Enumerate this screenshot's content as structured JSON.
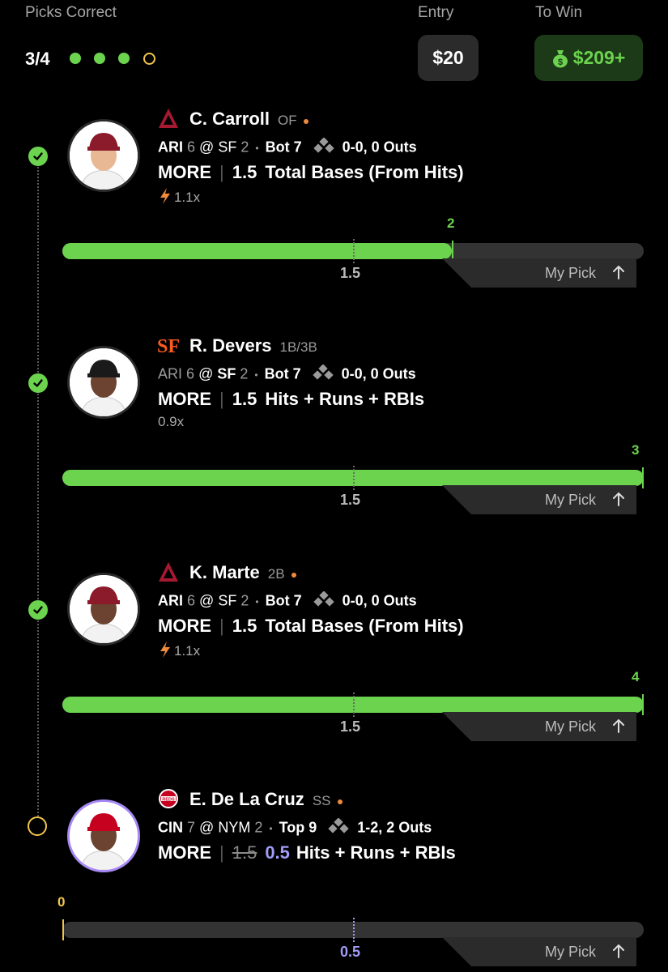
{
  "header": {
    "picks_label": "Picks Correct",
    "picks_count": "3/4",
    "progress": [
      true,
      true,
      true,
      false
    ],
    "entry_label": "Entry",
    "entry_value": "$20",
    "win_label": "To Win",
    "win_value": "$209+"
  },
  "picks": [
    {
      "player": "C. Carroll",
      "position": "OF",
      "live_dot": true,
      "team_logo": "diamondbacks-logo",
      "away": "ARI",
      "away_score": "6",
      "at": "@",
      "home": "SF",
      "home_score": "2",
      "inning": "Bot 7",
      "count": "0-0, 0 Outs",
      "direction": "MORE",
      "line": "1.5",
      "stat": "Total Bases (From Hits)",
      "multiplier": "1.1x",
      "boost_icon": true,
      "current": "2",
      "line_label": "1.5",
      "status": "correct",
      "progress_fraction": 0.67,
      "line_fraction": 0.5,
      "my_pick_label": "My Pick"
    },
    {
      "player": "R. Devers",
      "position": "1B/3B",
      "live_dot": false,
      "team_logo": "giants-logo",
      "away": "ARI",
      "away_score": "6",
      "at": "@",
      "home": "SF",
      "home_score": "2",
      "inning": "Bot 7",
      "count": "0-0, 0 Outs",
      "direction": "MORE",
      "line": "1.5",
      "stat": "Hits + Runs + RBIs",
      "multiplier": "0.9x",
      "boost_icon": false,
      "current": "3",
      "line_label": "1.5",
      "status": "correct",
      "progress_fraction": 1.0,
      "line_fraction": 0.5,
      "my_pick_label": "My Pick"
    },
    {
      "player": "K. Marte",
      "position": "2B",
      "live_dot": true,
      "team_logo": "diamondbacks-logo",
      "away": "ARI",
      "away_score": "6",
      "at": "@",
      "home": "SF",
      "home_score": "2",
      "inning": "Bot 7",
      "count": "0-0, 0 Outs",
      "direction": "MORE",
      "line": "1.5",
      "stat": "Total Bases (From Hits)",
      "multiplier": "1.1x",
      "boost_icon": true,
      "current": "4",
      "line_label": "1.5",
      "status": "correct",
      "progress_fraction": 1.0,
      "line_fraction": 0.5,
      "my_pick_label": "My Pick"
    },
    {
      "player": "E. De La Cruz",
      "position": "SS",
      "live_dot": true,
      "team_logo": "reds-logo",
      "away": "CIN",
      "away_score": "7",
      "at": "@",
      "home": "NYM",
      "home_score": "2",
      "inning": "Top 9",
      "count": "1-2, 2 Outs",
      "direction": "MORE",
      "old_line": "1.5",
      "line": "0.5",
      "stat": "Hits + Runs + RBIs",
      "current": "0",
      "line_label": "0.5",
      "status": "pending",
      "progress_fraction": 0.0,
      "line_fraction": 0.5,
      "my_pick_label": "My Pick"
    }
  ],
  "colors": {
    "green": "#6cd34f",
    "yellow": "#f0c64a",
    "purple": "#a09cf7",
    "orange": "#f08a3c"
  }
}
